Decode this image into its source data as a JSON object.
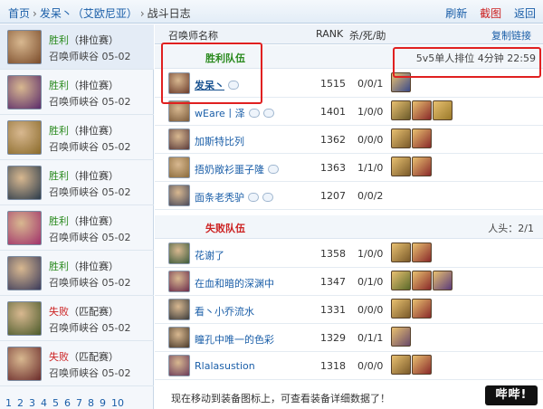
{
  "breadcrumb": {
    "home": "首页",
    "player": "发呆丶（艾欧尼亚）",
    "current": "战斗日志"
  },
  "toolbar": {
    "refresh": "刷新",
    "screenshot": "截图",
    "back": "返回"
  },
  "sidebar": {
    "matches": [
      {
        "result": "胜利",
        "mode": "（排位赛）",
        "map": "召唤师峡谷",
        "date": "05-02",
        "outcome": "win",
        "avatar_color": "#7a4b2a",
        "selected": true
      },
      {
        "result": "胜利",
        "mode": "（排位赛）",
        "map": "召唤师峡谷",
        "date": "05-02",
        "outcome": "win",
        "avatar_color": "#5a2a6a",
        "selected": false
      },
      {
        "result": "胜利",
        "mode": "（排位赛）",
        "map": "召唤师峡谷",
        "date": "05-02",
        "outcome": "win",
        "avatar_color": "#8a6a2a",
        "selected": false
      },
      {
        "result": "胜利",
        "mode": "（排位赛）",
        "map": "召唤师峡谷",
        "date": "05-02",
        "outcome": "win",
        "avatar_color": "#2a3a4a",
        "selected": false
      },
      {
        "result": "胜利",
        "mode": "（排位赛）",
        "map": "召唤师峡谷",
        "date": "05-02",
        "outcome": "win",
        "avatar_color": "#a0306a",
        "selected": false
      },
      {
        "result": "胜利",
        "mode": "（排位赛）",
        "map": "召唤师峡谷",
        "date": "05-02",
        "outcome": "win",
        "avatar_color": "#3a3a5a",
        "selected": false
      },
      {
        "result": "失败",
        "mode": "（匹配赛）",
        "map": "召唤师峡谷",
        "date": "05-02",
        "outcome": "lose",
        "avatar_color": "#4a5a2a",
        "selected": false
      },
      {
        "result": "失败",
        "mode": "（匹配赛）",
        "map": "召唤师峡谷",
        "date": "05-02",
        "outcome": "lose",
        "avatar_color": "#6a2a2a",
        "selected": false
      }
    ],
    "pages": [
      "1",
      "2",
      "3",
      "4",
      "5",
      "6",
      "7",
      "8",
      "9",
      "10"
    ]
  },
  "table": {
    "col_name": "召唤师名称",
    "col_rank": "RANK",
    "col_kda": "杀/死/助",
    "copy_link": "复制链接"
  },
  "winning_team": {
    "label": "胜利队伍",
    "game_info": "5v5单人排位 4分钟 22:59",
    "players": [
      {
        "name": "发呆丶",
        "rank": "1515",
        "kda": "0/0/1",
        "is_me": true,
        "icons": [
          "hand-icon"
        ],
        "champ_color": "#6a3a2a",
        "items": [
          "#3a4a8a"
        ]
      },
      {
        "name": "wEare丨泽",
        "rank": "1401",
        "kda": "1/0/0",
        "is_me": false,
        "icons": [
          "hand-icon",
          "cloud-icon"
        ],
        "champ_color": "#7a5a3a",
        "items": [
          "#6a5a2a",
          "#8a2a2a",
          "#9a7a2a"
        ]
      },
      {
        "name": "加斯特比列",
        "rank": "1362",
        "kda": "0/0/0",
        "is_me": false,
        "icons": [],
        "champ_color": "#5a3a3a",
        "items": [
          "#7a5a2a",
          "#8a2a2a"
        ]
      },
      {
        "name": "捂奶敞衫噩子隆",
        "rank": "1363",
        "kda": "1/1/0",
        "is_me": false,
        "icons": [
          "hand-icon"
        ],
        "champ_color": "#8a6a3a",
        "items": [
          "#7a5a2a",
          "#8a2a2a"
        ]
      },
      {
        "name": "面条老秃驴",
        "rank": "1207",
        "kda": "0/0/2",
        "is_me": false,
        "icons": [
          "shield-icon",
          "hand-icon"
        ],
        "champ_color": "#4a4a5a",
        "items": []
      }
    ]
  },
  "losing_team": {
    "label": "失败队伍",
    "heads": "人头：2/1",
    "players": [
      {
        "name": "花谢了",
        "rank": "1358",
        "kda": "1/0/0",
        "champ_color": "#3a5a3a",
        "items": [
          "#7a5a2a",
          "#8a2a2a"
        ]
      },
      {
        "name": "在血和暗的深渊中",
        "rank": "1347",
        "kda": "0/1/0",
        "champ_color": "#6a2a4a",
        "items": [
          "#5a6a2a",
          "#8a2a2a",
          "#5a3a7a"
        ]
      },
      {
        "name": "看丶小乔流水",
        "rank": "1331",
        "kda": "0/0/0",
        "champ_color": "#3a3a3a",
        "items": [
          "#7a5a2a",
          "#8a2a2a"
        ]
      },
      {
        "name": "瞳孔中唯一的色彩",
        "rank": "1329",
        "kda": "0/1/1",
        "champ_color": "#4a3a2a",
        "items": [
          "#6a4a6a"
        ]
      },
      {
        "name": "Rlalasustion",
        "rank": "1318",
        "kda": "0/0/0",
        "champ_color": "#6a3a5a",
        "items": [
          "#7a5a2a",
          "#8a2a2a"
        ]
      }
    ]
  },
  "footnote": "现在移动到装备图标上，可查看装备详细数据了！",
  "watermark": "哔哔!"
}
